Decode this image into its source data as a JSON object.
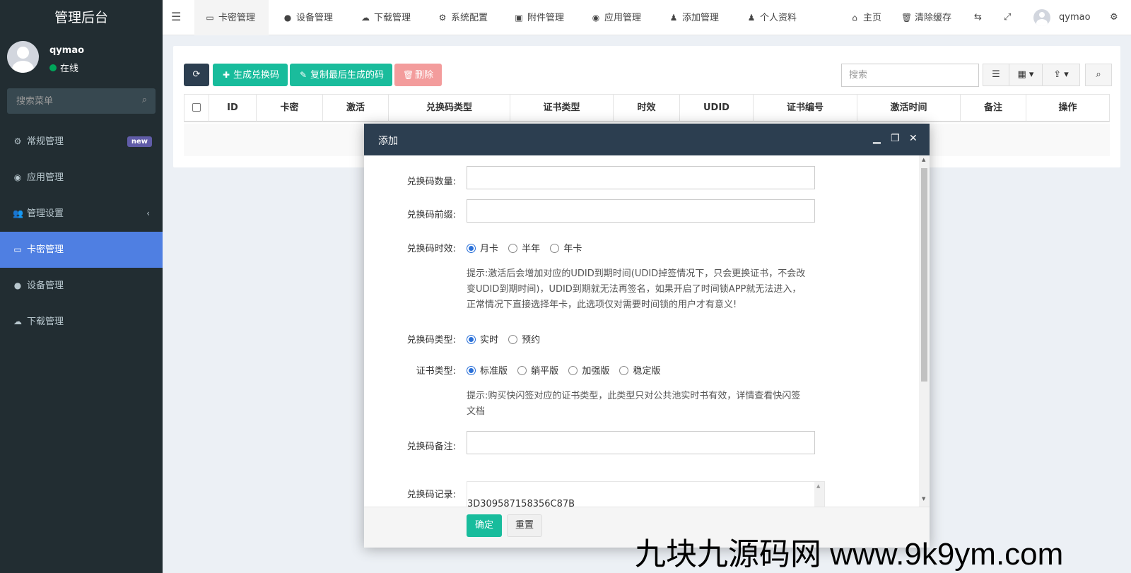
{
  "sidebar": {
    "brand": "管理后台",
    "user": {
      "name": "qymao",
      "status": "在线",
      "status_color": "#00a65a"
    },
    "search_placeholder": "搜索菜单",
    "items": [
      {
        "label": "常规管理",
        "icon": "gears-icon",
        "badge": "new"
      },
      {
        "label": "应用管理",
        "icon": "app-icon"
      },
      {
        "label": "管理设置",
        "icon": "users-icon"
      },
      {
        "label": "卡密管理",
        "icon": "card-icon",
        "active": true
      },
      {
        "label": "设备管理",
        "icon": "apple-icon"
      },
      {
        "label": "下载管理",
        "icon": "cloud-download-icon"
      }
    ]
  },
  "navbar": {
    "tabs": [
      {
        "label": "卡密管理",
        "icon": "card-icon"
      },
      {
        "label": "设备管理",
        "icon": "apple-icon"
      },
      {
        "label": "下载管理",
        "icon": "cloud-download-icon"
      },
      {
        "label": "系统配置",
        "icon": "gear-icon"
      },
      {
        "label": "附件管理",
        "icon": "image-icon"
      },
      {
        "label": "应用管理",
        "icon": "app-icon"
      },
      {
        "label": "添加管理",
        "icon": "user-icon"
      },
      {
        "label": "个人资料",
        "icon": "user-icon"
      }
    ],
    "home": "主页",
    "clear_cache": "清除缓存",
    "username": "qymao"
  },
  "toolbar": {
    "generate": "生成兑换码",
    "copy_last": "复制最后生成的码",
    "delete": "删除",
    "search_placeholder": "搜索",
    "colors": {
      "refresh": "#2c3e50",
      "generate": "#18bc9c",
      "copy": "#1abc9c",
      "delete": "#f39c9c"
    }
  },
  "table": {
    "columns": [
      "ID",
      "卡密",
      "激活",
      "兑换码类型",
      "证书类型",
      "时效",
      "UDID",
      "证书编号",
      "激活时间",
      "备注",
      "操作"
    ]
  },
  "modal": {
    "title": "添加",
    "fields": {
      "count_label": "兑换码数量:",
      "prefix_label": "兑换码前缀:",
      "validity_label": "兑换码时效:",
      "validity_options": [
        "月卡",
        "半年",
        "年卡"
      ],
      "validity_hint": "提示:激活后会增加对应的UDID到期时间(UDID掉签情况下，只会更换证书，不会改变UDID到期时间)，UDID到期就无法再签名，如果开启了时间锁APP就无法进入，正常情况下直接选择年卡，此选项仅对需要时间锁的用户才有意义!",
      "type_label": "兑换码类型:",
      "type_options": [
        "实时",
        "预约"
      ],
      "cert_label": "证书类型:",
      "cert_options": [
        "标准版",
        "躺平版",
        "加强版",
        "稳定版"
      ],
      "cert_hint": "提示:购买快闪签对应的证书类型，此类型只对公共池实时书有效，详情查看快闪签文档",
      "remark_label": "兑换码备注:",
      "record_label": "兑换码记录:",
      "record_value": "3D309587158356C87B"
    },
    "ok": "确定",
    "reset": "重置"
  },
  "watermark": "九块九源码网 www.9k9ym.com"
}
